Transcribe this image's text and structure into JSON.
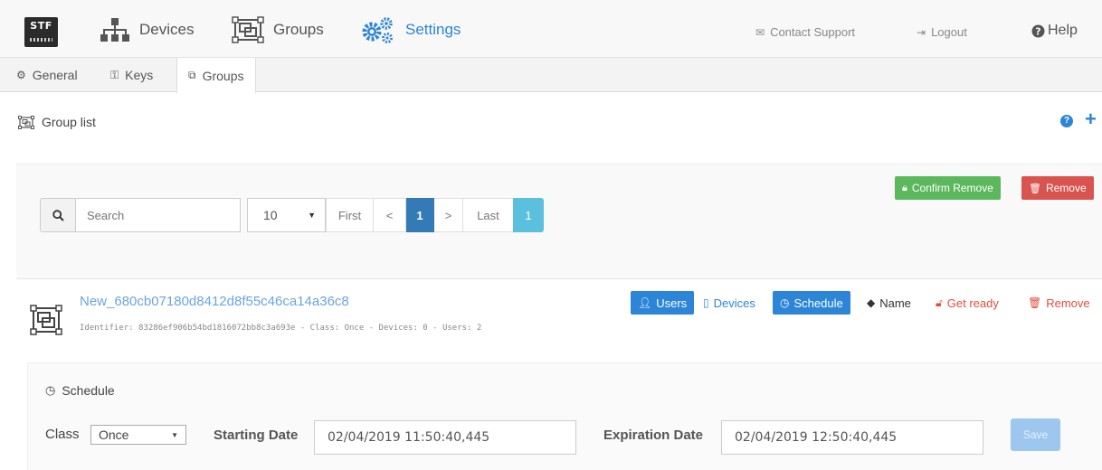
{
  "header": {
    "logo_text": "STF",
    "nav": {
      "devices": "Devices",
      "groups": "Groups",
      "settings": "Settings"
    },
    "contact_support": "Contact Support",
    "logout": "Logout",
    "help": "Help"
  },
  "tabs": {
    "general": "General",
    "keys": "Keys",
    "groups": "Groups"
  },
  "group_list": {
    "title": "Group list"
  },
  "toolbar": {
    "confirm_remove": "Confirm Remove",
    "remove": "Remove",
    "search_placeholder": "Search",
    "page_size": "10",
    "first": "First",
    "prev": "<",
    "current_page": "1",
    "next": ">",
    "last": "Last",
    "total_pages": "1"
  },
  "group": {
    "name": "New_680cb07180d8412d8f55c46ca14a36c8",
    "meta": "Identifier: 83286ef906b54bd1816072bb8c3a693e - Class: Once - Devices: 0 - Users: 2",
    "actions": {
      "users": "Users",
      "devices": "Devices",
      "schedule": "Schedule",
      "name": "Name",
      "get_ready": "Get ready",
      "remove": "Remove"
    }
  },
  "schedule": {
    "title": "Schedule",
    "class_label": "Class",
    "class_value": "Once",
    "starting_label": "Starting Date",
    "starting_value": "02/04/2019 11:50:40,445",
    "expiration_label": "Expiration Date",
    "expiration_value": "02/04/2019 12:50:40,445",
    "save": "Save"
  },
  "colors": {
    "primary": "#2c85d6",
    "success": "#5cb85c",
    "danger": "#d9534f",
    "info": "#5bc0de",
    "page_active": "#337ab7"
  }
}
